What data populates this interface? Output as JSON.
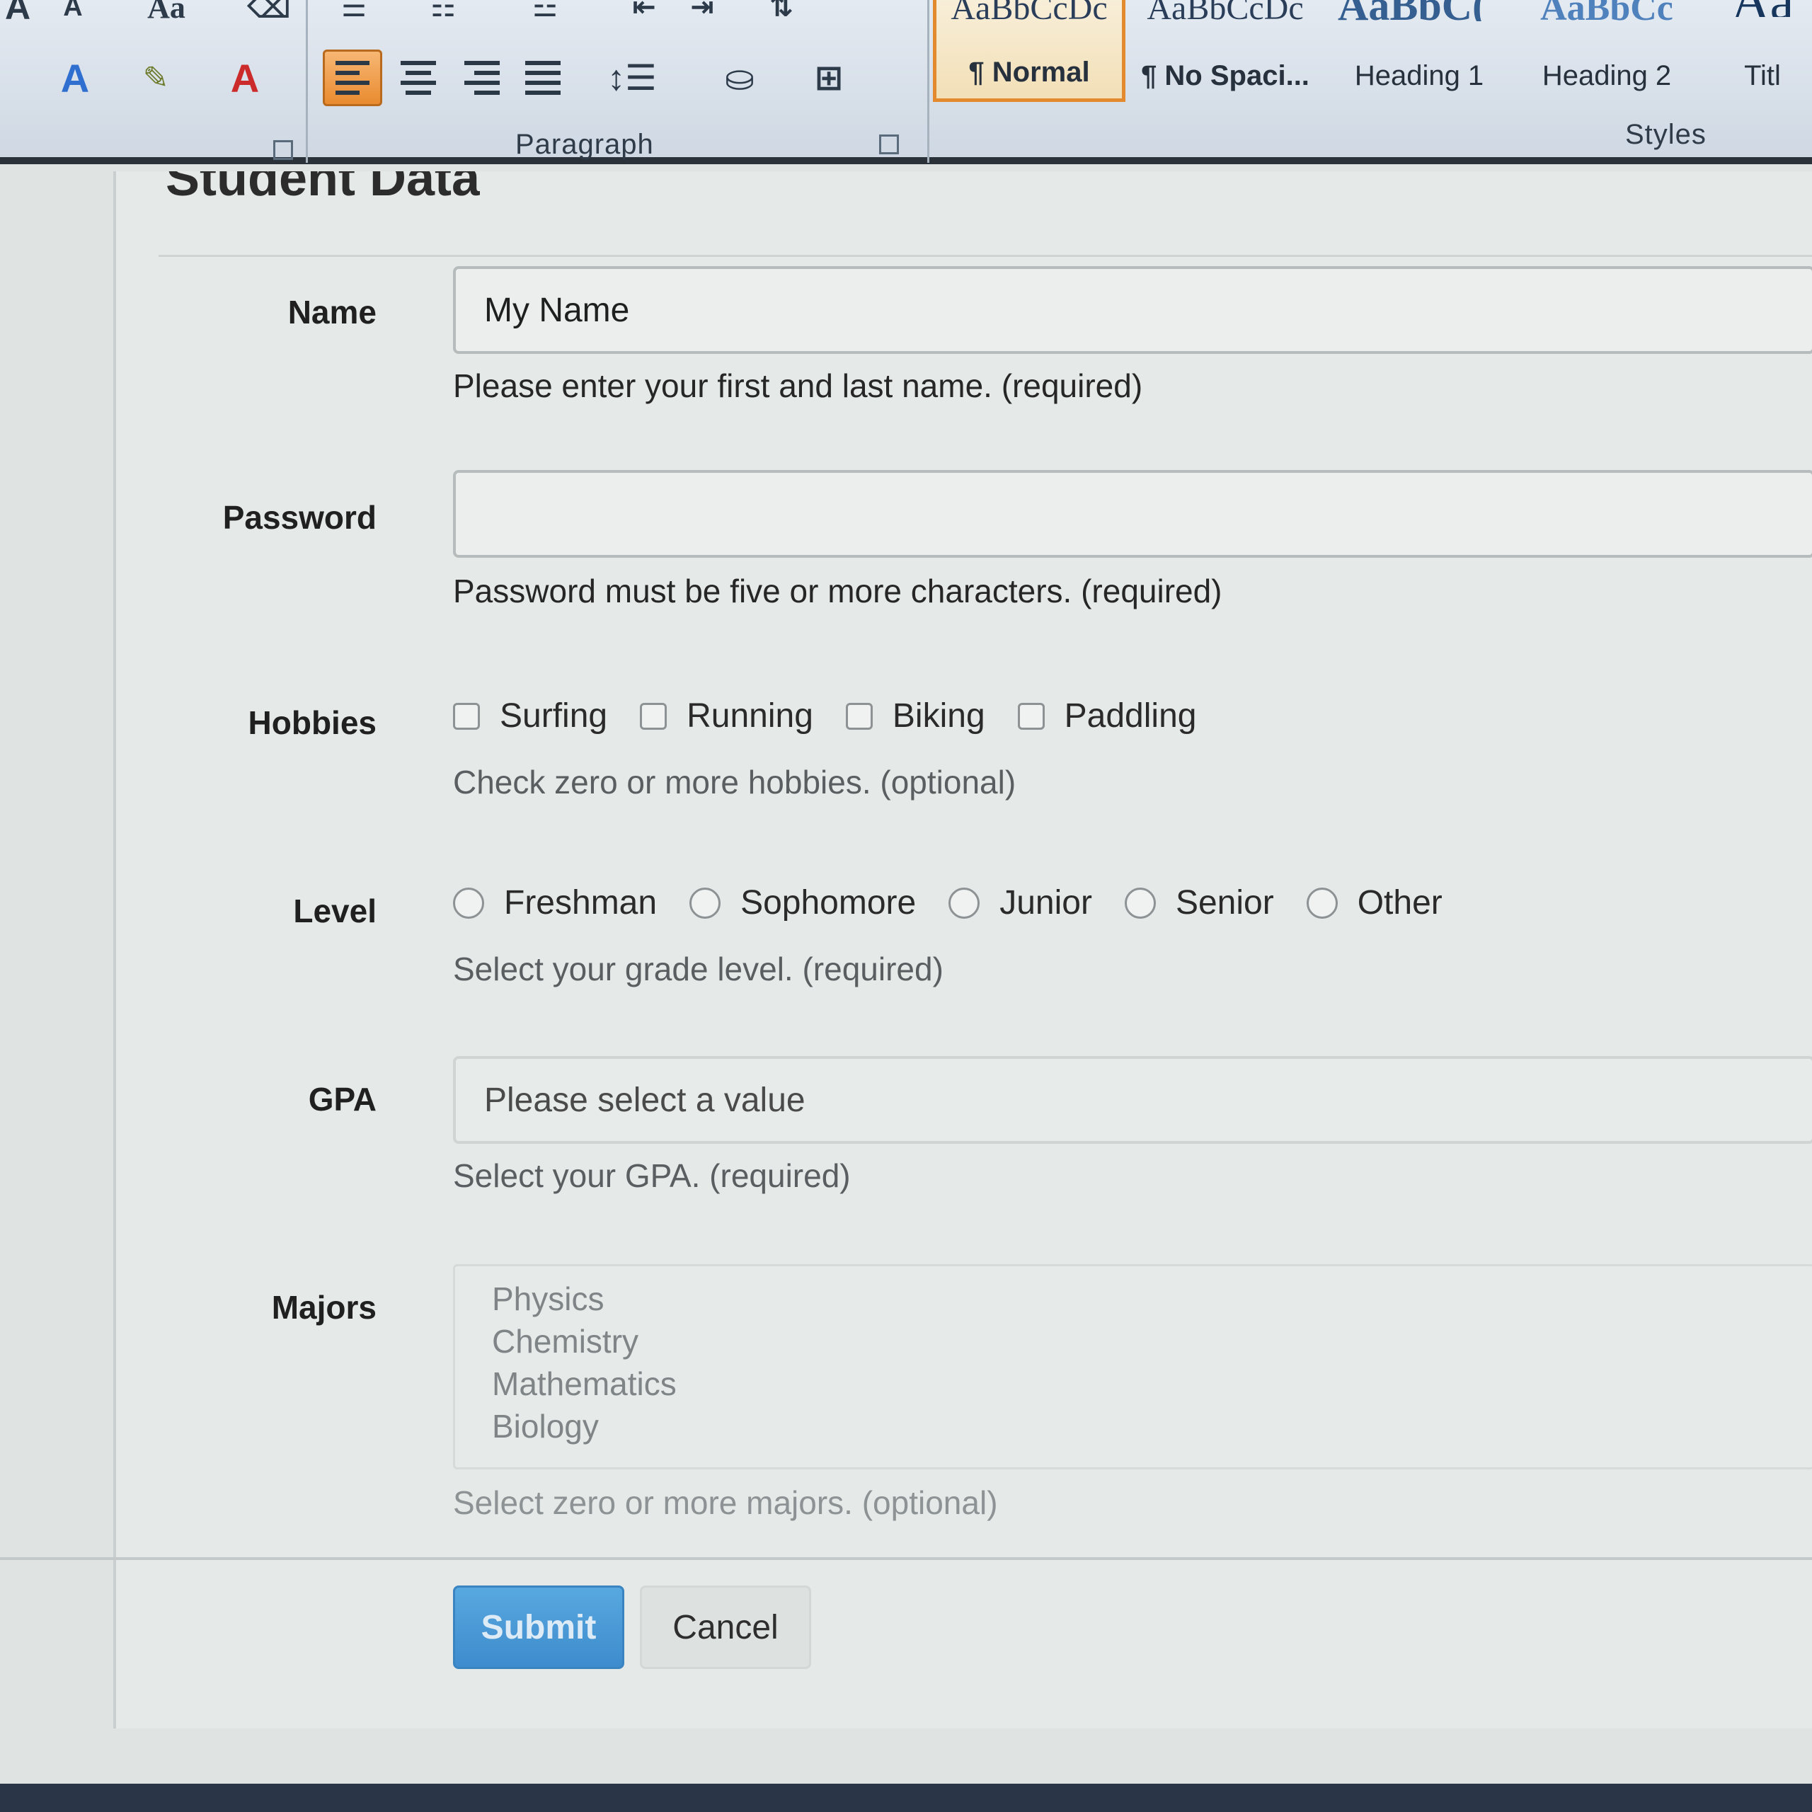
{
  "ribbon": {
    "paragraph_group_label": "Paragraph",
    "styles_group_label": "Styles",
    "styles": [
      {
        "sample": "AaBbCcDc",
        "name": "¶ Normal",
        "selected": true
      },
      {
        "sample": "AaBbCcDc",
        "name": "¶ No Spaci...",
        "selected": false
      },
      {
        "sample": "AaBbC(",
        "name": "Heading 1",
        "selected": false
      },
      {
        "sample": "AaBbCc",
        "name": "Heading 2",
        "selected": false
      },
      {
        "sample": "Aa",
        "name": "Titl",
        "selected": false
      }
    ],
    "accent_color": "#e98b2f"
  },
  "form": {
    "section_title": "Student Data",
    "name": {
      "label": "Name",
      "value": "My Name",
      "help": "Please enter your first and last name. (required)"
    },
    "password": {
      "label": "Password",
      "value": "",
      "help": "Password must be five or more characters. (required)"
    },
    "hobbies": {
      "label": "Hobbies",
      "options": [
        "Surfing",
        "Running",
        "Biking",
        "Paddling"
      ],
      "help": "Check zero or more hobbies. (optional)"
    },
    "level": {
      "label": "Level",
      "options": [
        "Freshman",
        "Sophomore",
        "Junior",
        "Senior",
        "Other"
      ],
      "help": "Select your grade level. (required)"
    },
    "gpa": {
      "label": "GPA",
      "placeholder": "Please select a value",
      "help": "Select your GPA. (required)"
    },
    "majors": {
      "label": "Majors",
      "options": [
        "Physics",
        "Chemistry",
        "Mathematics",
        "Biology"
      ],
      "help": "Select zero or more majors. (optional)"
    },
    "submit_label": "Submit",
    "cancel_label": "Cancel",
    "submit_color": "#3e8ccd"
  }
}
